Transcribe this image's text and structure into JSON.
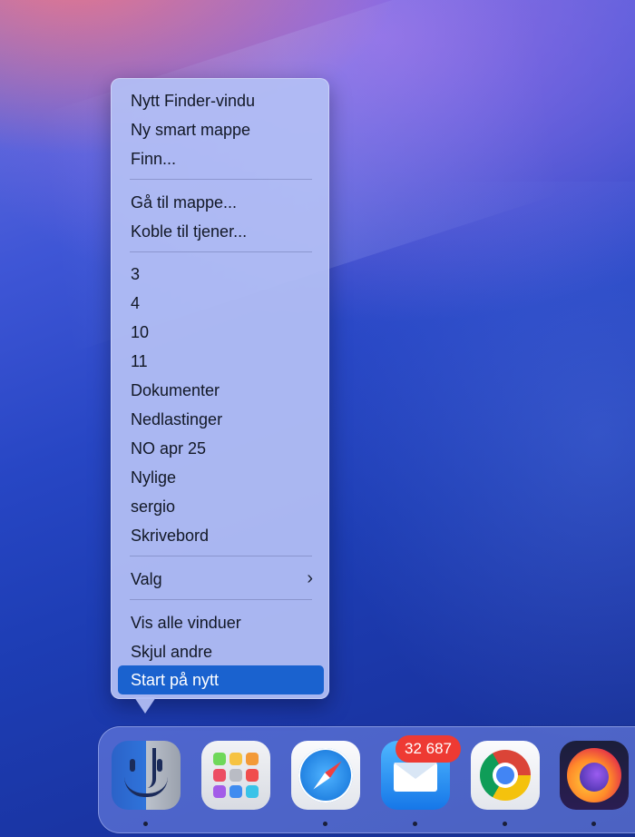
{
  "context_menu": {
    "items": [
      {
        "label": "Nytt Finder-vindu"
      },
      {
        "label": "Ny smart mappe"
      },
      {
        "label": "Finn..."
      },
      {
        "label": "Gå til mappe..."
      },
      {
        "label": "Koble til tjener..."
      },
      {
        "label": "3"
      },
      {
        "label": "4"
      },
      {
        "label": "10"
      },
      {
        "label": "11"
      },
      {
        "label": "Dokumenter"
      },
      {
        "label": "Nedlastinger"
      },
      {
        "label": "NO apr 25"
      },
      {
        "label": "Nylige"
      },
      {
        "label": "sergio"
      },
      {
        "label": "Skrivebord"
      },
      {
        "label": "Valg",
        "submenu_glyph": "›"
      },
      {
        "label": "Vis alle vinduer"
      },
      {
        "label": "Skjul andre"
      },
      {
        "label": "Start på nytt",
        "highlighted": true
      }
    ],
    "highlight_color": "#1a62cf"
  },
  "dock": {
    "apps": [
      {
        "icon": "finder-icon",
        "running": true
      },
      {
        "icon": "launchpad-icon",
        "running": false
      },
      {
        "icon": "safari-icon",
        "running": true
      },
      {
        "icon": "mail-icon",
        "running": true,
        "badge": "32 687"
      },
      {
        "icon": "chrome-icon",
        "running": true
      },
      {
        "icon": "firefox-icon",
        "running": true
      }
    ],
    "badge_color": "#ee3a33"
  }
}
